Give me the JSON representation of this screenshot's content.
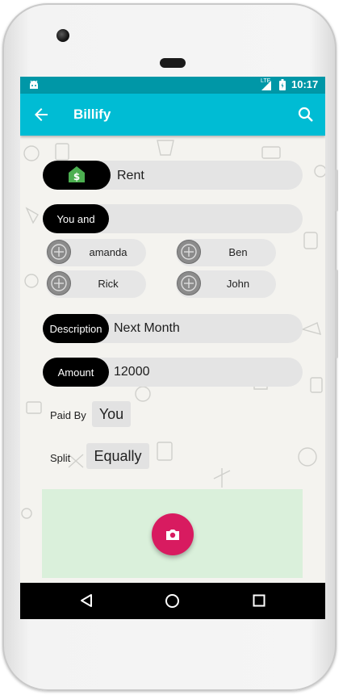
{
  "status_bar": {
    "time": "10:17",
    "network": "LTE"
  },
  "app_bar": {
    "title": "Billify"
  },
  "category": {
    "value": "Rent"
  },
  "friends": {
    "tag_label": "You and",
    "chips": [
      "amanda",
      "Ben",
      "Rick",
      "John"
    ]
  },
  "description": {
    "tag_label": "Description",
    "value": "Next Month"
  },
  "amount": {
    "tag_label": "Amount",
    "value": "12000"
  },
  "paid_by": {
    "label": "Paid By",
    "value": "You"
  },
  "split": {
    "label": "Split",
    "value": "Equally"
  },
  "colors": {
    "status_bar": "#0097a7",
    "app_bar": "#00bcd4",
    "fab": "#d81b60",
    "photo_area": "#daf0db",
    "category_icon": "#4caf50"
  },
  "icons": [
    "back-arrow-icon",
    "search-icon",
    "home-dollar-icon",
    "add-person-icon",
    "camera-icon",
    "nav-back-icon",
    "nav-home-icon",
    "nav-recents-icon"
  ]
}
